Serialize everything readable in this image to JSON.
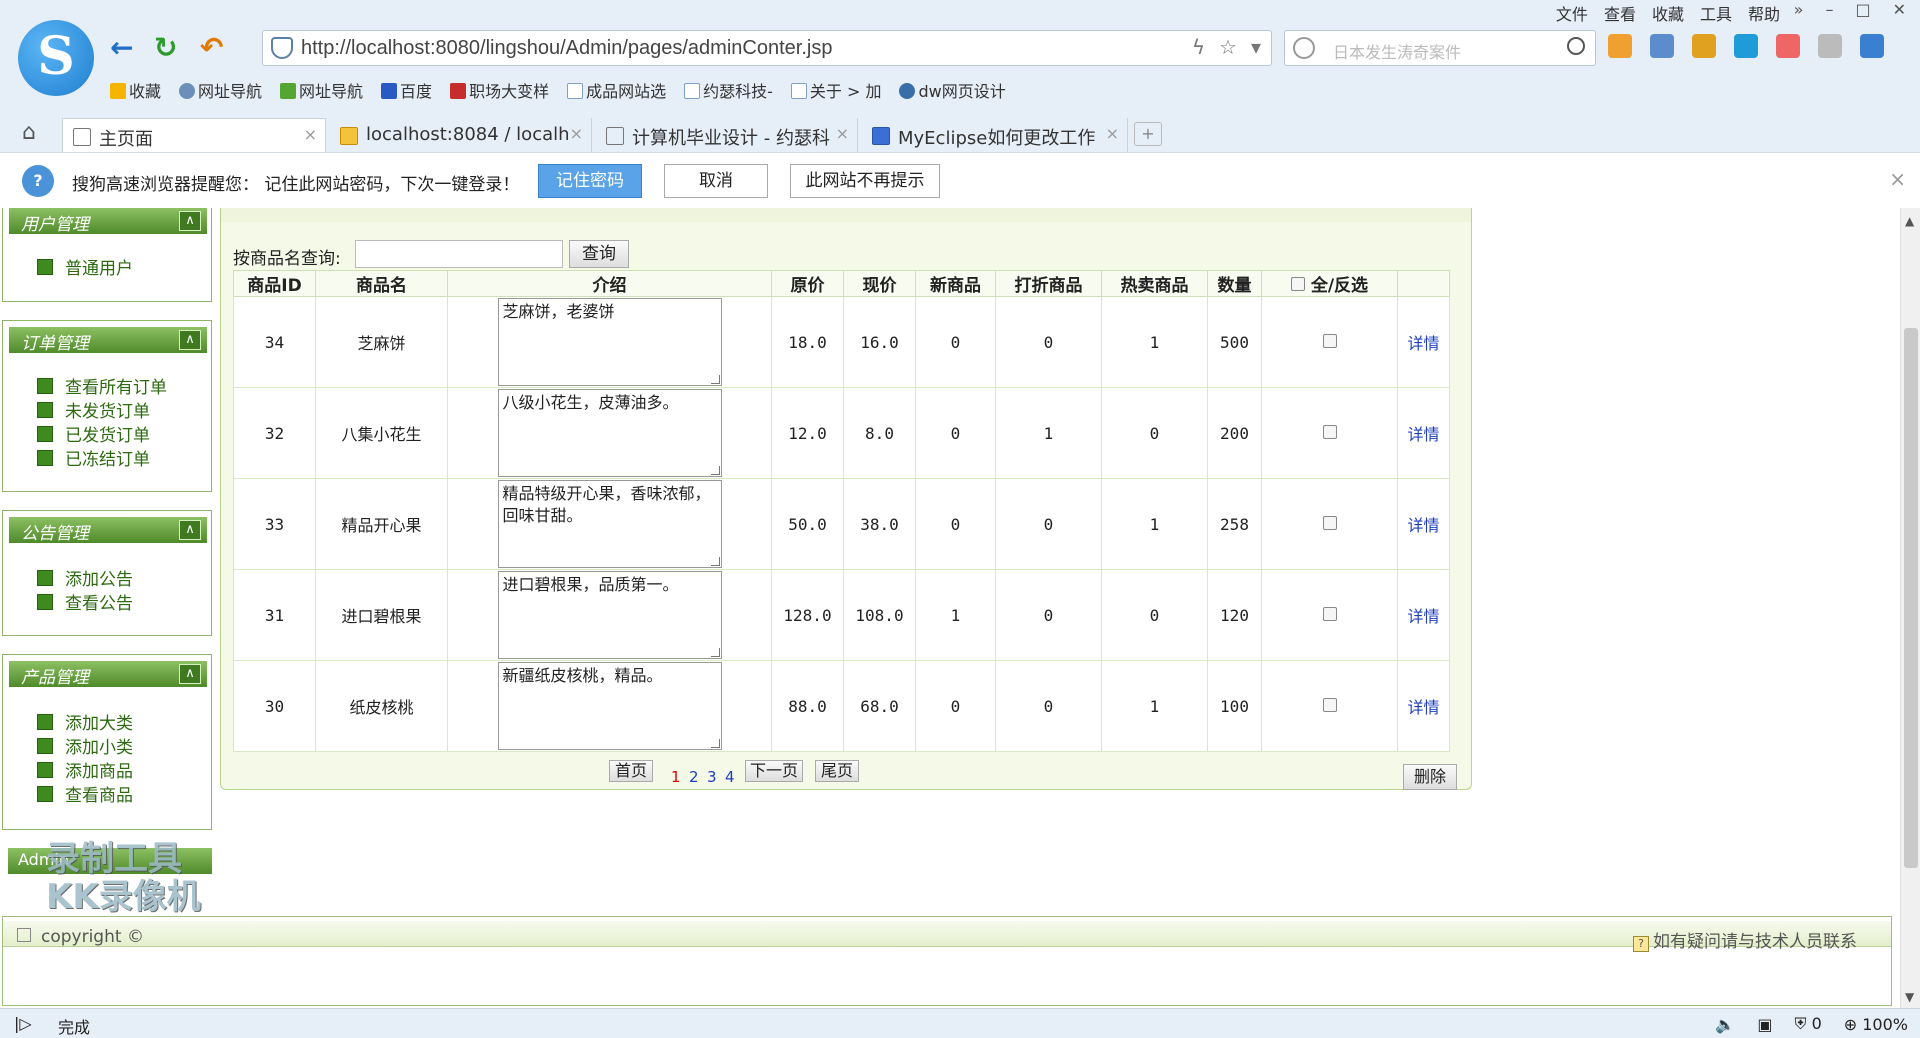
{
  "browser": {
    "logo_letter": "S",
    "menu": [
      "文件",
      "查看",
      "收藏",
      "工具",
      "帮助"
    ],
    "window_controls": [
      "»",
      "–",
      "□",
      "✕"
    ],
    "address_url": "http://localhost:8080/lingshou/Admin/pages/adminConter.jsp",
    "search_placeholder": "日本发生涛奇案件",
    "bookmarks": [
      {
        "label": "收藏",
        "color": "#f4b400"
      },
      {
        "label": "网址导航",
        "color": "#6b8fb8"
      },
      {
        "label": "网址导航",
        "color": "#55a532"
      },
      {
        "label": "百度",
        "color": "#2b59c3"
      },
      {
        "label": "职场大变样",
        "color": "#c62d2d"
      },
      {
        "label": "成品网站选",
        "color": "#7fa0c8"
      },
      {
        "label": "约瑟科技-",
        "color": "#7fa0c8"
      },
      {
        "label": "关于 > 加",
        "color": "#7fa0c8"
      },
      {
        "label": "dw网页设计",
        "color": "#3a6ea8"
      }
    ],
    "tabs": [
      {
        "label": "主页面",
        "close": "×"
      },
      {
        "label": "localhost:8084 / localh",
        "close": "×"
      },
      {
        "label": "计算机毕业设计 - 约瑟科",
        "close": "×"
      },
      {
        "label": "MyEclipse如何更改工作",
        "close": "×"
      }
    ],
    "new_tab": "+",
    "notification": {
      "icon": "?",
      "message": "搜狗高速浏览器提醒您：  记住此网站密码，下次一键登录！",
      "remember": "记住密码",
      "cancel": "取消",
      "never": "此网站不再提示",
      "close": "×"
    }
  },
  "sidebar": {
    "sections": [
      {
        "title": "用户管理",
        "items": [
          "普通用户"
        ]
      },
      {
        "title": "订单管理",
        "items": [
          "查看所有订单",
          "未发货订单",
          "已发货订单",
          "已冻结订单"
        ]
      },
      {
        "title": "公告管理",
        "items": [
          "添加公告",
          "查看公告"
        ]
      },
      {
        "title": "产品管理",
        "items": [
          "添加大类",
          "添加小类",
          "添加商品",
          "查看商品"
        ]
      }
    ],
    "collapse_glyph": "∧",
    "admin_label": "Admin",
    "watermark": "录制工具\nKK录像机"
  },
  "main": {
    "query_label": "按商品名查询:",
    "query_value": "",
    "query_button": "查询",
    "headers": [
      "商品ID",
      "商品名",
      "介绍",
      "原价",
      "现价",
      "新商品",
      "打折商品",
      "热卖商品",
      "数量",
      "全/反选",
      ""
    ],
    "rows": [
      {
        "id": "34",
        "name": "芝麻饼",
        "intro": "芝麻饼，老婆饼",
        "orig": "18.0",
        "now": "16.0",
        "new": "0",
        "discount": "0",
        "hot": "1",
        "qty": "500",
        "detail": "详情"
      },
      {
        "id": "32",
        "name": "八集小花生",
        "intro": "八级小花生，皮薄油多。",
        "orig": "12.0",
        "now": "8.0",
        "new": "0",
        "discount": "1",
        "hot": "0",
        "qty": "200",
        "detail": "详情"
      },
      {
        "id": "33",
        "name": "精品开心果",
        "intro": "精品特级开心果，香味浓郁，回味甘甜。",
        "orig": "50.0",
        "now": "38.0",
        "new": "0",
        "discount": "0",
        "hot": "1",
        "qty": "258",
        "detail": "详情"
      },
      {
        "id": "31",
        "name": "进口碧根果",
        "intro": "进口碧根果，品质第一。",
        "orig": "128.0",
        "now": "108.0",
        "new": "1",
        "discount": "0",
        "hot": "0",
        "qty": "120",
        "detail": "详情"
      },
      {
        "id": "30",
        "name": "纸皮核桃",
        "intro": "新疆纸皮核桃，精品。",
        "orig": "88.0",
        "now": "68.0",
        "new": "0",
        "discount": "0",
        "hot": "1",
        "qty": "100",
        "detail": "详情"
      }
    ],
    "pager": {
      "first": "首页",
      "pages": [
        "1",
        "2",
        "3",
        "4"
      ],
      "current": "1",
      "next": "下一页",
      "last": "尾页"
    },
    "delete_button": "删除"
  },
  "footer": {
    "copyright": "copyright ©",
    "contact": "如有疑问请与技术人员联系"
  },
  "statusbar": {
    "status": "完成",
    "mute": "🔈",
    "counter": "0",
    "zoom": "100%"
  }
}
